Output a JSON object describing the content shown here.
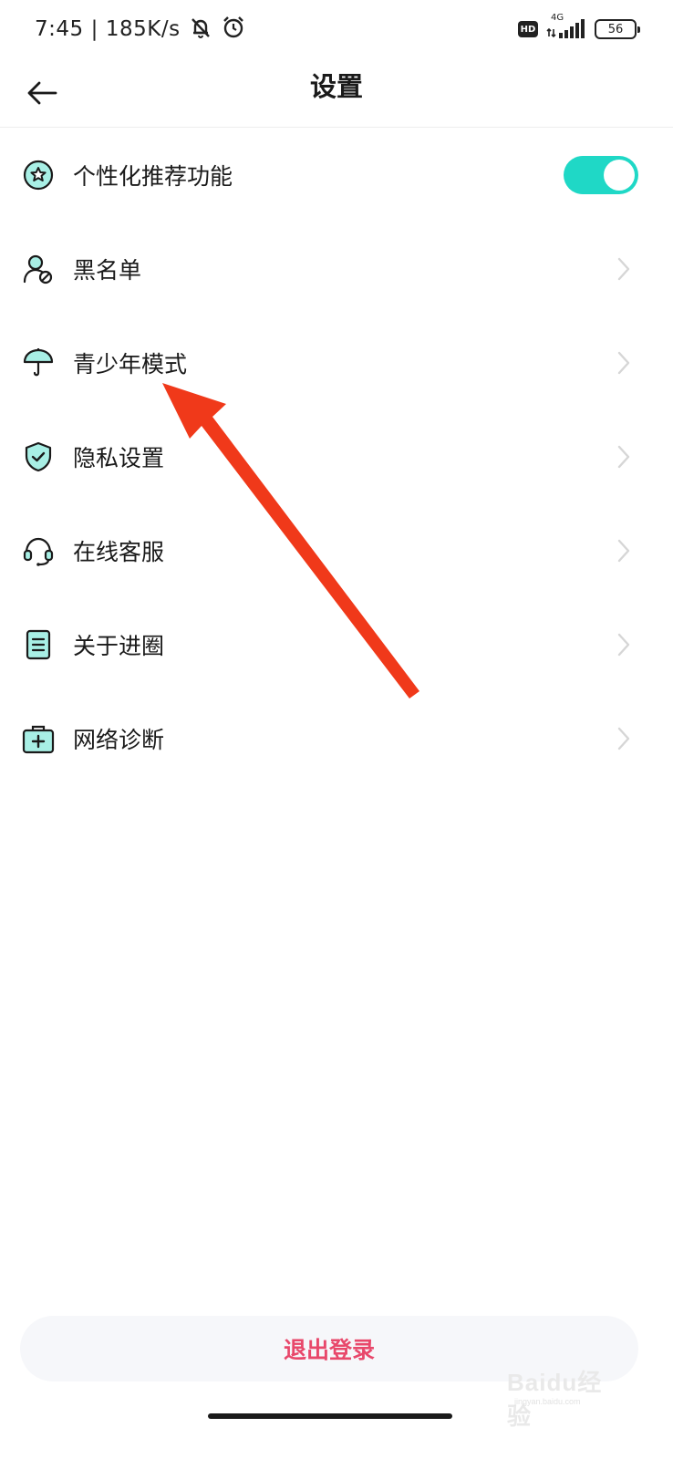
{
  "status_bar": {
    "time": "7:45",
    "speed": "185K/s",
    "network_type": "4G",
    "battery_level": "56",
    "icons": [
      "mute-icon",
      "alarm-icon",
      "hd-icon",
      "signal-icon",
      "battery-icon"
    ]
  },
  "header": {
    "title": "设置",
    "back_icon": "back-arrow-icon"
  },
  "settings": {
    "items": [
      {
        "label": "个性化推荐功能",
        "icon": "star-badge-icon",
        "control": "toggle",
        "toggle_on": true
      },
      {
        "label": "黑名单",
        "icon": "user-block-icon",
        "control": "chevron"
      },
      {
        "label": "青少年模式",
        "icon": "umbrella-icon",
        "control": "chevron"
      },
      {
        "label": "隐私设置",
        "icon": "shield-check-icon",
        "control": "chevron"
      },
      {
        "label": "在线客服",
        "icon": "headset-icon",
        "control": "chevron"
      },
      {
        "label": "关于进圈",
        "icon": "document-icon",
        "control": "chevron"
      },
      {
        "label": "网络诊断",
        "icon": "medical-kit-icon",
        "control": "chevron"
      }
    ]
  },
  "logout": {
    "label": "退出登录"
  },
  "watermark": {
    "text": "Baidu经验",
    "sub": "jingyan.baidu.com"
  },
  "colors": {
    "accent": "#1fd8c6",
    "icon_fill": "#a8efe5",
    "logout_text": "#e8486b",
    "annotation_arrow": "#f0391a"
  }
}
